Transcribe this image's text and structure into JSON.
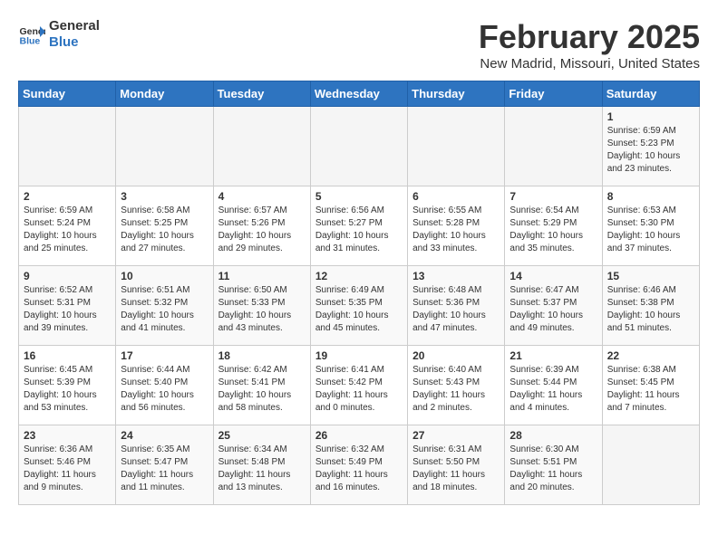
{
  "header": {
    "logo_line1": "General",
    "logo_line2": "Blue",
    "title": "February 2025",
    "location": "New Madrid, Missouri, United States"
  },
  "days_of_week": [
    "Sunday",
    "Monday",
    "Tuesday",
    "Wednesday",
    "Thursday",
    "Friday",
    "Saturday"
  ],
  "weeks": [
    [
      {
        "day": "",
        "info": ""
      },
      {
        "day": "",
        "info": ""
      },
      {
        "day": "",
        "info": ""
      },
      {
        "day": "",
        "info": ""
      },
      {
        "day": "",
        "info": ""
      },
      {
        "day": "",
        "info": ""
      },
      {
        "day": "1",
        "info": "Sunrise: 6:59 AM\nSunset: 5:23 PM\nDaylight: 10 hours\nand 23 minutes."
      }
    ],
    [
      {
        "day": "2",
        "info": "Sunrise: 6:59 AM\nSunset: 5:24 PM\nDaylight: 10 hours\nand 25 minutes."
      },
      {
        "day": "3",
        "info": "Sunrise: 6:58 AM\nSunset: 5:25 PM\nDaylight: 10 hours\nand 27 minutes."
      },
      {
        "day": "4",
        "info": "Sunrise: 6:57 AM\nSunset: 5:26 PM\nDaylight: 10 hours\nand 29 minutes."
      },
      {
        "day": "5",
        "info": "Sunrise: 6:56 AM\nSunset: 5:27 PM\nDaylight: 10 hours\nand 31 minutes."
      },
      {
        "day": "6",
        "info": "Sunrise: 6:55 AM\nSunset: 5:28 PM\nDaylight: 10 hours\nand 33 minutes."
      },
      {
        "day": "7",
        "info": "Sunrise: 6:54 AM\nSunset: 5:29 PM\nDaylight: 10 hours\nand 35 minutes."
      },
      {
        "day": "8",
        "info": "Sunrise: 6:53 AM\nSunset: 5:30 PM\nDaylight: 10 hours\nand 37 minutes."
      }
    ],
    [
      {
        "day": "9",
        "info": "Sunrise: 6:52 AM\nSunset: 5:31 PM\nDaylight: 10 hours\nand 39 minutes."
      },
      {
        "day": "10",
        "info": "Sunrise: 6:51 AM\nSunset: 5:32 PM\nDaylight: 10 hours\nand 41 minutes."
      },
      {
        "day": "11",
        "info": "Sunrise: 6:50 AM\nSunset: 5:33 PM\nDaylight: 10 hours\nand 43 minutes."
      },
      {
        "day": "12",
        "info": "Sunrise: 6:49 AM\nSunset: 5:35 PM\nDaylight: 10 hours\nand 45 minutes."
      },
      {
        "day": "13",
        "info": "Sunrise: 6:48 AM\nSunset: 5:36 PM\nDaylight: 10 hours\nand 47 minutes."
      },
      {
        "day": "14",
        "info": "Sunrise: 6:47 AM\nSunset: 5:37 PM\nDaylight: 10 hours\nand 49 minutes."
      },
      {
        "day": "15",
        "info": "Sunrise: 6:46 AM\nSunset: 5:38 PM\nDaylight: 10 hours\nand 51 minutes."
      }
    ],
    [
      {
        "day": "16",
        "info": "Sunrise: 6:45 AM\nSunset: 5:39 PM\nDaylight: 10 hours\nand 53 minutes."
      },
      {
        "day": "17",
        "info": "Sunrise: 6:44 AM\nSunset: 5:40 PM\nDaylight: 10 hours\nand 56 minutes."
      },
      {
        "day": "18",
        "info": "Sunrise: 6:42 AM\nSunset: 5:41 PM\nDaylight: 10 hours\nand 58 minutes."
      },
      {
        "day": "19",
        "info": "Sunrise: 6:41 AM\nSunset: 5:42 PM\nDaylight: 11 hours\nand 0 minutes."
      },
      {
        "day": "20",
        "info": "Sunrise: 6:40 AM\nSunset: 5:43 PM\nDaylight: 11 hours\nand 2 minutes."
      },
      {
        "day": "21",
        "info": "Sunrise: 6:39 AM\nSunset: 5:44 PM\nDaylight: 11 hours\nand 4 minutes."
      },
      {
        "day": "22",
        "info": "Sunrise: 6:38 AM\nSunset: 5:45 PM\nDaylight: 11 hours\nand 7 minutes."
      }
    ],
    [
      {
        "day": "23",
        "info": "Sunrise: 6:36 AM\nSunset: 5:46 PM\nDaylight: 11 hours\nand 9 minutes."
      },
      {
        "day": "24",
        "info": "Sunrise: 6:35 AM\nSunset: 5:47 PM\nDaylight: 11 hours\nand 11 minutes."
      },
      {
        "day": "25",
        "info": "Sunrise: 6:34 AM\nSunset: 5:48 PM\nDaylight: 11 hours\nand 13 minutes."
      },
      {
        "day": "26",
        "info": "Sunrise: 6:32 AM\nSunset: 5:49 PM\nDaylight: 11 hours\nand 16 minutes."
      },
      {
        "day": "27",
        "info": "Sunrise: 6:31 AM\nSunset: 5:50 PM\nDaylight: 11 hours\nand 18 minutes."
      },
      {
        "day": "28",
        "info": "Sunrise: 6:30 AM\nSunset: 5:51 PM\nDaylight: 11 hours\nand 20 minutes."
      },
      {
        "day": "",
        "info": ""
      }
    ]
  ]
}
